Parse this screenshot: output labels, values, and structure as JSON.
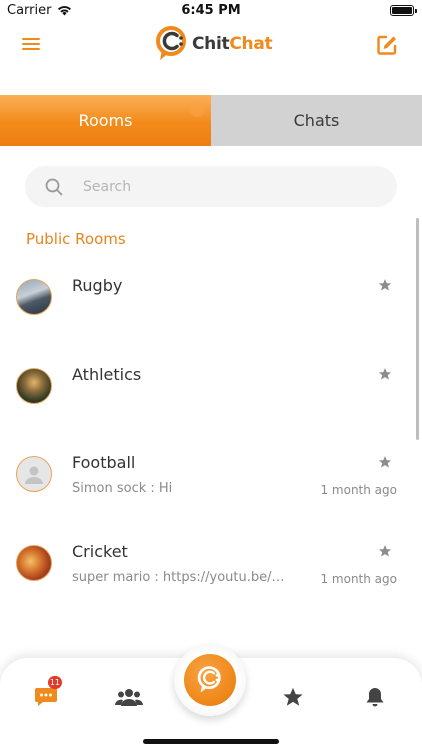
{
  "status_bar": {
    "carrier": "Carrier",
    "time": "6:45 PM"
  },
  "header": {
    "logo_part1": "Chit",
    "logo_part2": "Chat"
  },
  "tabs": [
    {
      "label": "Rooms",
      "active": true
    },
    {
      "label": "Chats",
      "active": false
    }
  ],
  "search": {
    "placeholder": "Search",
    "value": ""
  },
  "section_title": "Public Rooms",
  "rooms": [
    {
      "name": "Rugby",
      "last_message": "",
      "time": ""
    },
    {
      "name": "Athletics",
      "last_message": "",
      "time": ""
    },
    {
      "name": "Football",
      "last_message": "Simon sock : Hi",
      "time": "1 month ago"
    },
    {
      "name": "Cricket",
      "last_message": "super mario : https://youtu.be/…",
      "time": "1 month ago"
    }
  ],
  "bottom_nav": {
    "chats_badge": "11",
    "items": [
      "chats-icon",
      "groups-icon",
      "center-chitchat-icon",
      "star-icon",
      "bell-icon"
    ]
  },
  "colors": {
    "accent": "#f08a1c",
    "tab_inactive": "#d2d2d2",
    "badge": "#e03b2b"
  }
}
